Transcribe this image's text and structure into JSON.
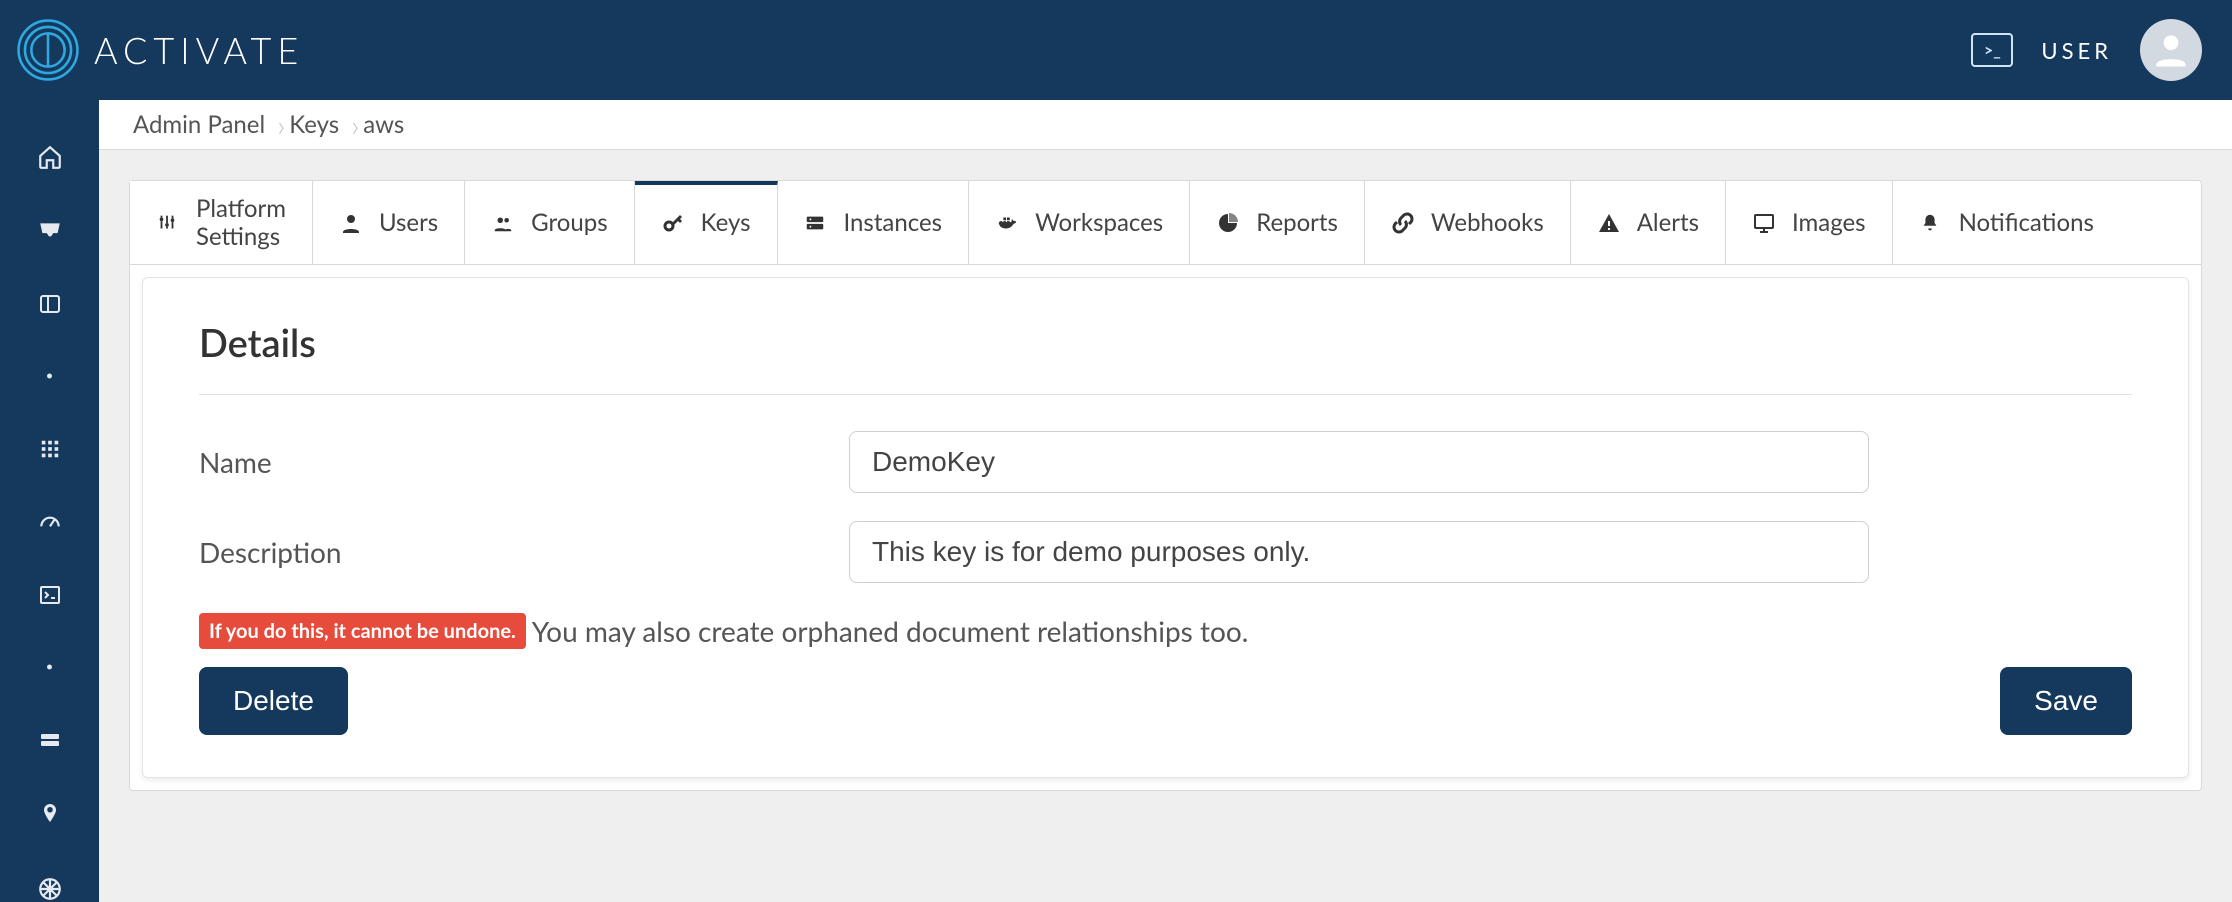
{
  "brand": "ACTIVATE",
  "header": {
    "user_label": "USER"
  },
  "breadcrumbs": [
    "Admin Panel",
    "Keys",
    "aws"
  ],
  "tabs": [
    {
      "label": "Platform\nSettings",
      "icon": "settings-sliders-icon",
      "active": false
    },
    {
      "label": "Users",
      "icon": "user-icon",
      "active": false
    },
    {
      "label": "Groups",
      "icon": "group-icon",
      "active": false
    },
    {
      "label": "Keys",
      "icon": "key-icon",
      "active": true
    },
    {
      "label": "Instances",
      "icon": "server-icon",
      "active": false
    },
    {
      "label": "Workspaces",
      "icon": "docker-icon",
      "active": false
    },
    {
      "label": "Reports",
      "icon": "pie-chart-icon",
      "active": false
    },
    {
      "label": "Webhooks",
      "icon": "link-icon",
      "active": false
    },
    {
      "label": "Alerts",
      "icon": "alert-icon",
      "active": false
    },
    {
      "label": "Images",
      "icon": "monitor-icon",
      "active": false
    },
    {
      "label": "Notifications",
      "icon": "bell-icon",
      "active": false
    }
  ],
  "panel": {
    "title": "Details",
    "name_label": "Name",
    "name_value": "DemoKey",
    "description_label": "Description",
    "description_value": "This key is for demo purposes only.",
    "warn_badge": "If you do this, it cannot be undone.",
    "warn_text": "You may also create orphaned document relationships too.",
    "delete_label": "Delete",
    "save_label": "Save"
  },
  "sidebar_items": [
    "home-icon",
    "inbox-icon",
    "panel-icon",
    "dot-icon",
    "grid-icon",
    "gauge-icon",
    "terminal-icon",
    "dot-icon",
    "storage-icon",
    "pin-icon",
    "wheel-icon"
  ]
}
